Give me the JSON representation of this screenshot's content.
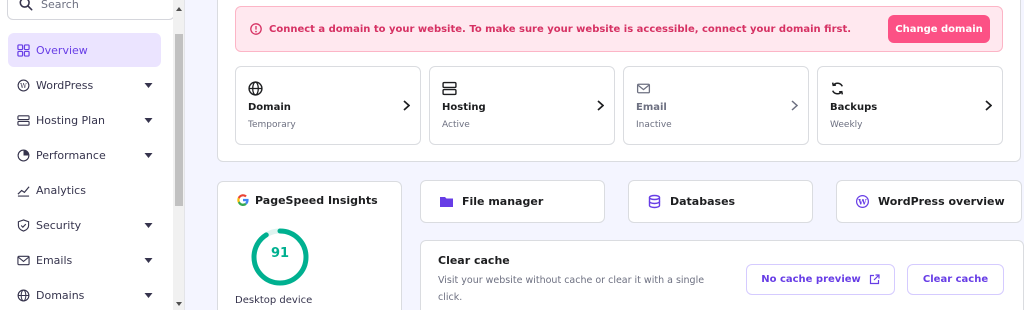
{
  "search": {
    "placeholder": "Search"
  },
  "sidebar": {
    "items": [
      {
        "label": "Overview",
        "active": true,
        "icon": "overview-icon"
      },
      {
        "label": "WordPress",
        "icon": "wordpress-icon",
        "expandable": true
      },
      {
        "label": "Hosting Plan",
        "icon": "server-icon",
        "expandable": true
      },
      {
        "label": "Performance",
        "icon": "performance-icon",
        "expandable": true
      },
      {
        "label": "Analytics",
        "icon": "analytics-icon"
      },
      {
        "label": "Security",
        "icon": "shield-icon",
        "expandable": true
      },
      {
        "label": "Emails",
        "icon": "mail-icon",
        "expandable": true
      },
      {
        "label": "Domains",
        "icon": "globe-icon",
        "expandable": true
      }
    ]
  },
  "alert": {
    "message": "Connect a domain to your website. To make sure your website is accessible, connect your domain first.",
    "button_label": "Change domain"
  },
  "cards": [
    {
      "title": "Domain",
      "status": "Temporary",
      "icon": "globe-icon"
    },
    {
      "title": "Hosting",
      "status": "Active",
      "icon": "server-icon"
    },
    {
      "title": "Email",
      "status": "Inactive",
      "icon": "mail-icon"
    },
    {
      "title": "Backups",
      "status": "Weekly",
      "icon": "backup-icon"
    }
  ],
  "pagespeed": {
    "title": "PageSpeed Insights",
    "score": "91",
    "score_fraction": 0.91,
    "device": "Desktop device"
  },
  "quick_links": [
    {
      "label": "File manager",
      "icon": "folder-icon"
    },
    {
      "label": "Databases",
      "icon": "database-icon"
    },
    {
      "label": "WordPress overview",
      "icon": "wordpress-icon"
    }
  ],
  "cache": {
    "title": "Clear cache",
    "description": "Visit your website without cache or clear it with a single click.",
    "preview_label": "No cache preview",
    "clear_label": "Clear cache"
  },
  "colors": {
    "accent": "#673de6",
    "alert": "#d63163",
    "alert_button": "#fc5185",
    "score": "#00b090"
  }
}
